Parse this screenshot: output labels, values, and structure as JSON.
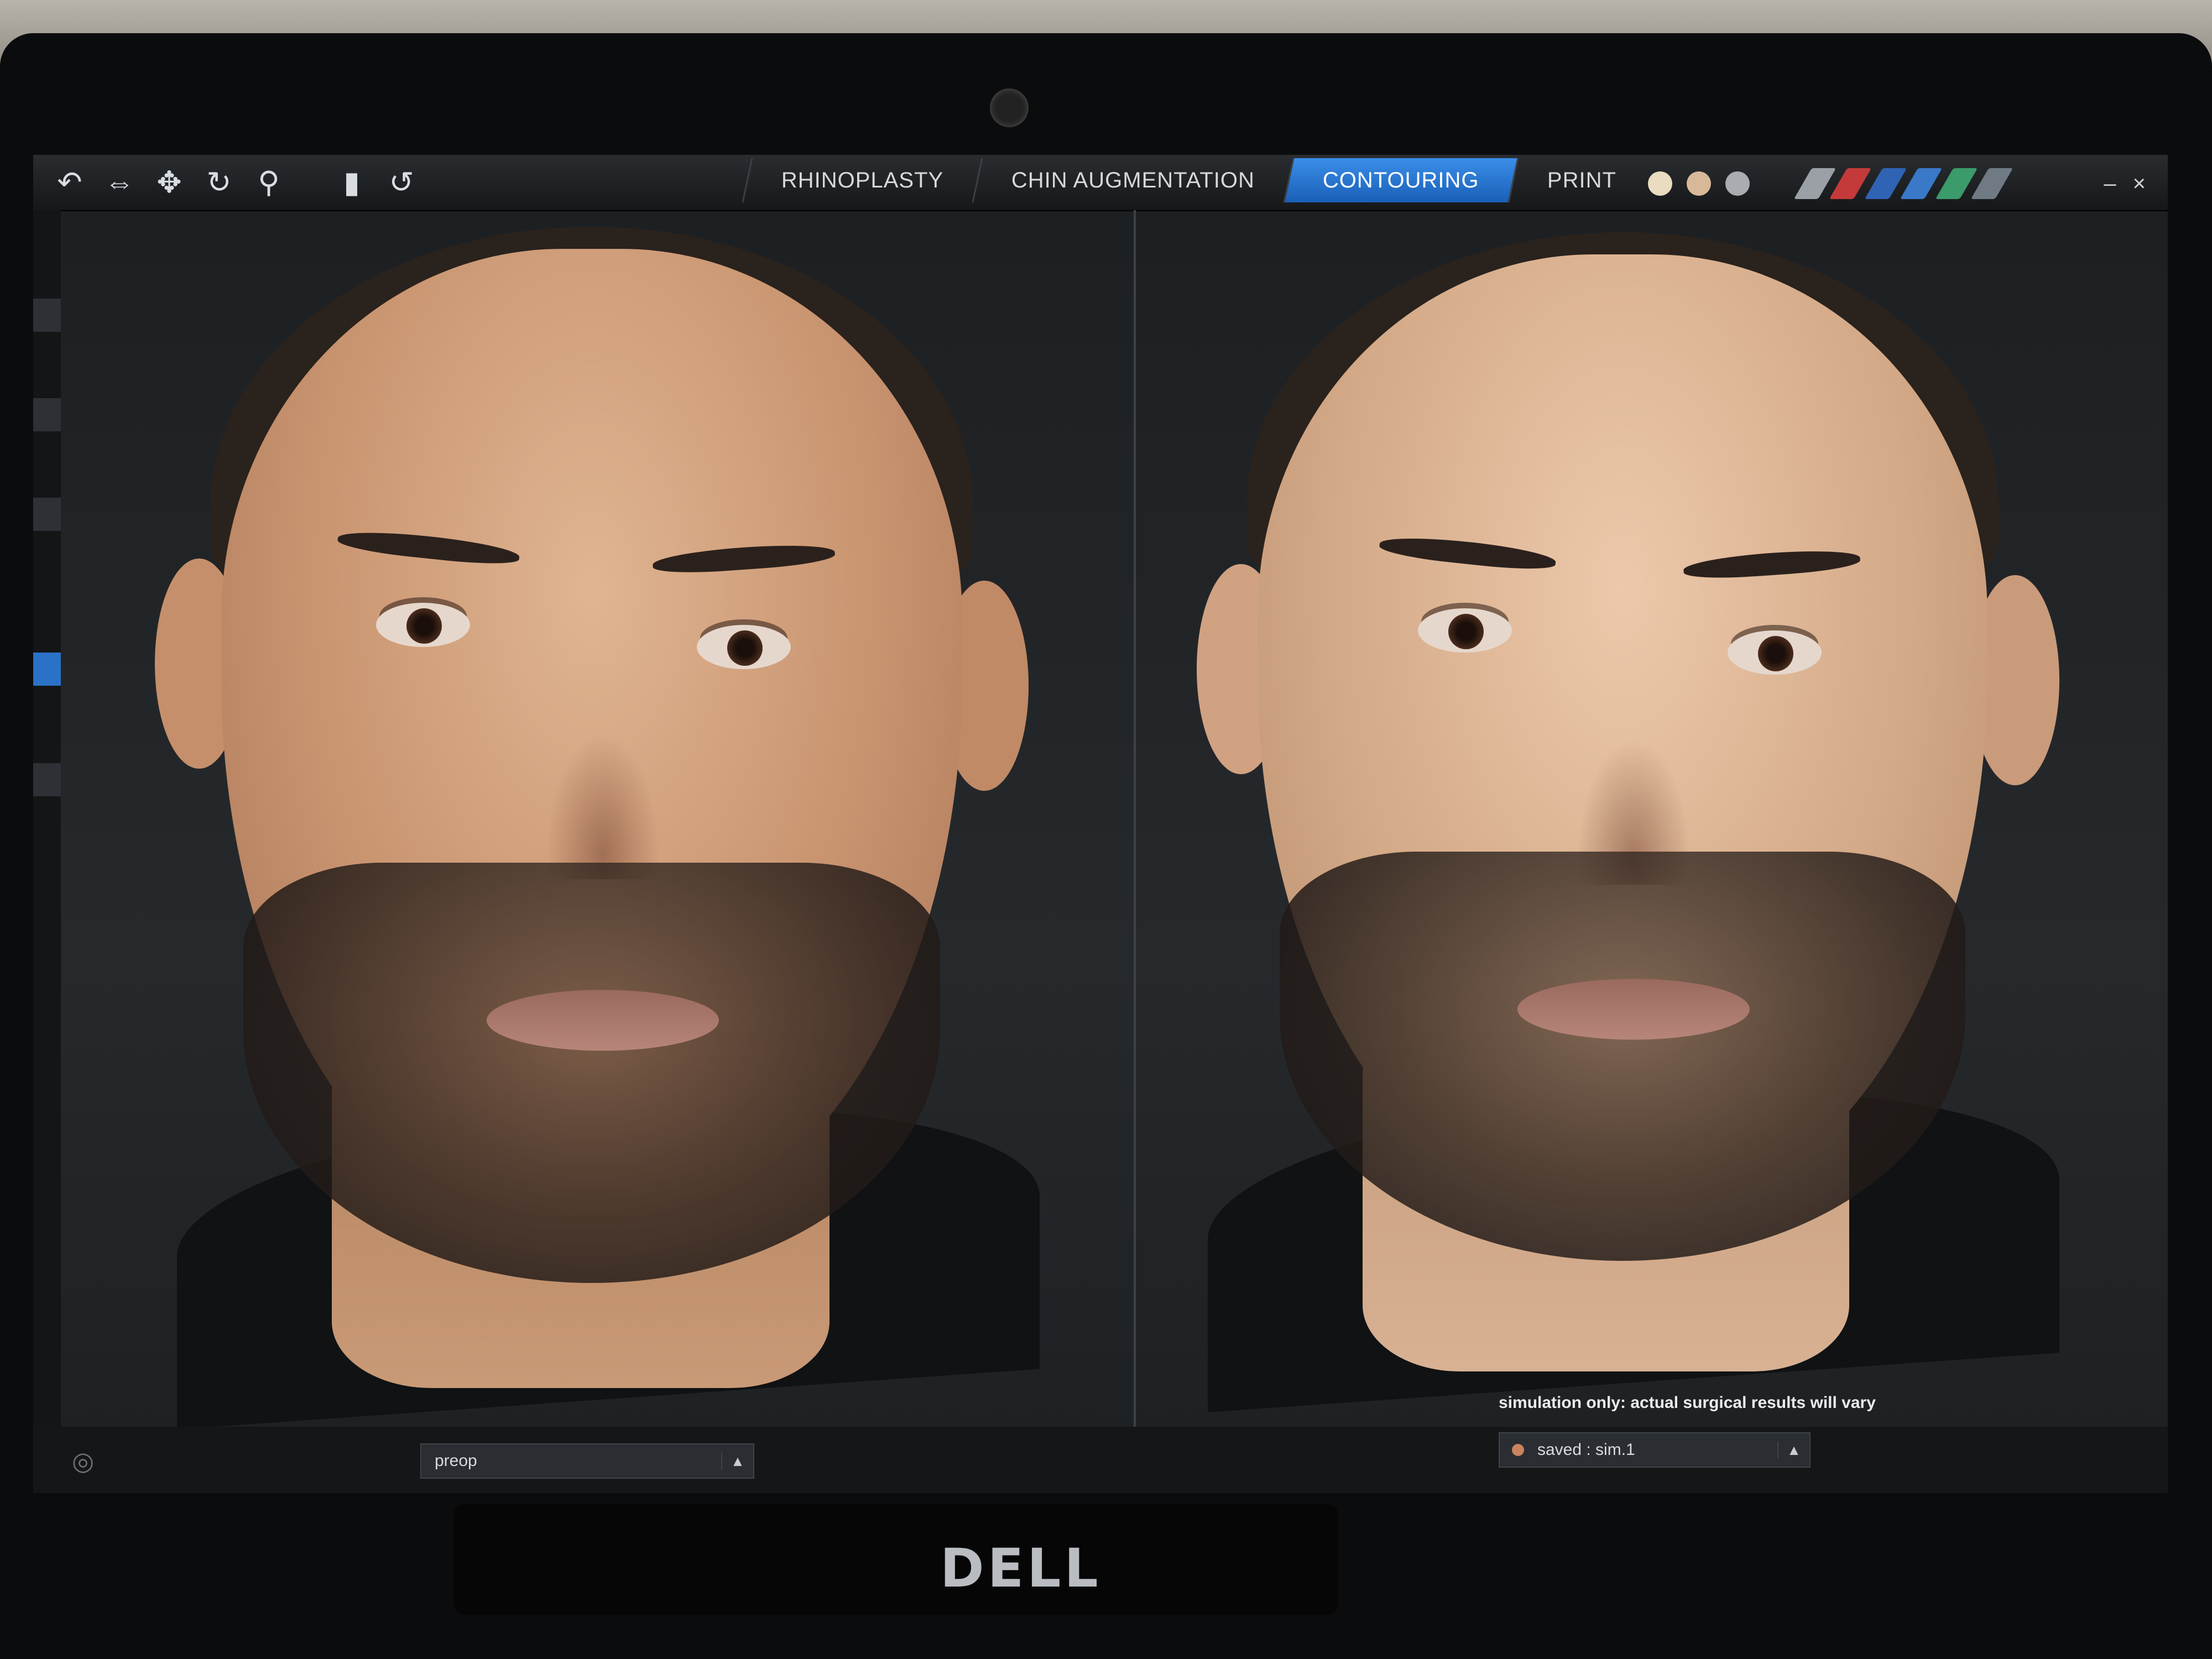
{
  "toolbar": {
    "tools": [
      {
        "name": "undo-icon",
        "glyph": "↶"
      },
      {
        "name": "pan-horizontal-icon",
        "glyph": "⇔"
      },
      {
        "name": "move-icon",
        "glyph": "✥"
      },
      {
        "name": "rotate-icon",
        "glyph": "↻"
      },
      {
        "name": "zoom-icon",
        "glyph": "⚲"
      },
      {
        "name": "marker-icon",
        "glyph": "▮"
      },
      {
        "name": "reset-view-icon",
        "glyph": "↺"
      }
    ],
    "tabs": [
      {
        "label": "RHINOPLASTY",
        "active": false
      },
      {
        "label": "CHIN AUGMENTATION",
        "active": false
      },
      {
        "label": "CONTOURING",
        "active": true
      },
      {
        "label": "PRINT",
        "active": false
      }
    ],
    "swatch_colors": [
      "#e9dcc1",
      "#d7b99a",
      "#a9adb1"
    ],
    "pen_colors": [
      "#9aa0a6",
      "#c43a3a",
      "#2f63b3",
      "#3a78c8",
      "#3b9b6a",
      "#6f7a85"
    ],
    "window_controls": {
      "minimize": "–",
      "close": "×"
    }
  },
  "accent_color": "#2a7fe0",
  "status": {
    "disclaimer": "simulation only: actual surgical results will vary",
    "left_selector": {
      "value": "preop",
      "arrow": "▲"
    },
    "right_selector": {
      "value": "saved : sim.1",
      "arrow": "▲"
    }
  },
  "hardware": {
    "brand": "DELL"
  }
}
